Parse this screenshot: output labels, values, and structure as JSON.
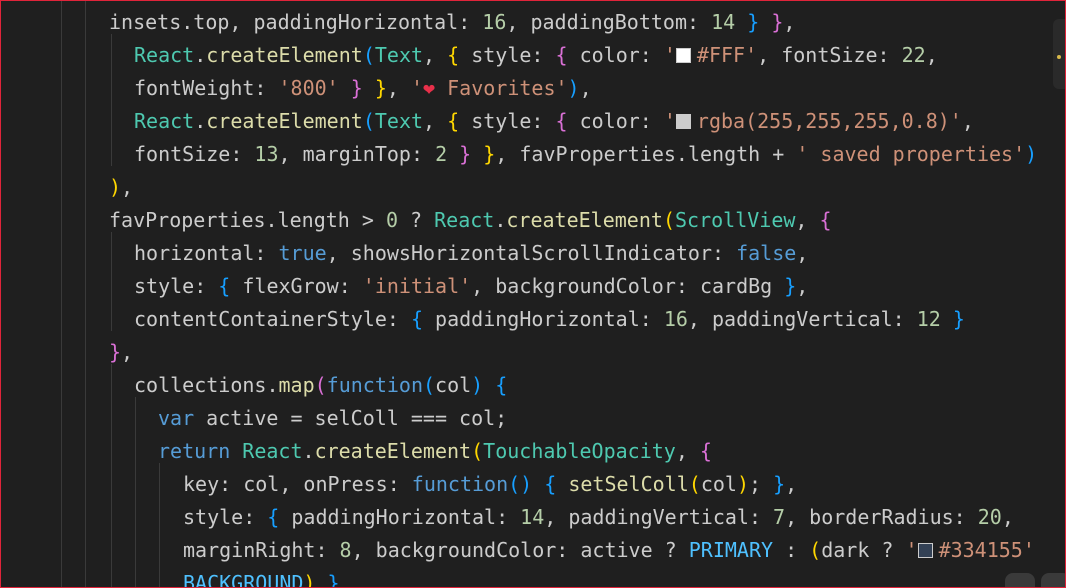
{
  "colors": {
    "background": "#1f1f1f",
    "frame_border": "#e0243a",
    "plain": "#cccccc",
    "variable": "#9cdcfe",
    "number": "#b5cea8",
    "string": "#ce9178",
    "component": "#4ec9b0",
    "keyword": "#569cd6",
    "function": "#dcdcaa",
    "constant": "#4fc1ff",
    "bracket_level_1": "#ffd700",
    "bracket_level_2": "#da70d6",
    "bracket_level_3": "#179fff"
  },
  "icons": {
    "heart": "heart-icon",
    "color_swatch": "color-swatch-icon"
  },
  "code_lines": [
    [
      {
        "t": "insets.top, paddingHorizontal: ",
        "c": "c-text"
      },
      {
        "t": "16",
        "c": "c-num"
      },
      {
        "t": ", paddingBottom: ",
        "c": "c-text"
      },
      {
        "t": "14",
        "c": "c-num"
      },
      {
        "t": " ",
        "c": "c-text"
      },
      {
        "t": "}",
        "c": "b3"
      },
      {
        "t": " ",
        "c": "c-text"
      },
      {
        "t": "}",
        "c": "b2"
      },
      {
        "t": ",",
        "c": "c-text"
      }
    ],
    [
      {
        "t": "React",
        "c": "c-cls"
      },
      {
        "t": ".",
        "c": "c-text"
      },
      {
        "t": "createElement",
        "c": "c-fn"
      },
      {
        "t": "(",
        "c": "b3"
      },
      {
        "t": "Text",
        "c": "c-cls"
      },
      {
        "t": ", ",
        "c": "c-text"
      },
      {
        "t": "{",
        "c": "b1"
      },
      {
        "t": " style: ",
        "c": "c-text"
      },
      {
        "t": "{",
        "c": "b2"
      },
      {
        "t": " color: ",
        "c": "c-text"
      },
      {
        "t": "'",
        "c": "c-str"
      },
      {
        "sw": "#ffffff"
      },
      {
        "t": "#FFF'",
        "c": "c-str"
      },
      {
        "t": ", fontSize: ",
        "c": "c-text"
      },
      {
        "t": "22",
        "c": "c-num"
      },
      {
        "t": ",",
        "c": "c-text"
      }
    ],
    [
      {
        "t": "fontWeight: ",
        "c": "c-text"
      },
      {
        "t": "'800'",
        "c": "c-str"
      },
      {
        "t": " ",
        "c": "c-text"
      },
      {
        "t": "}",
        "c": "b2"
      },
      {
        "t": " ",
        "c": "c-text"
      },
      {
        "t": "}",
        "c": "b1"
      },
      {
        "t": ", ",
        "c": "c-text"
      },
      {
        "t": "'",
        "c": "c-str"
      },
      {
        "t": "❤",
        "c": "heart",
        "n": "heart-icon"
      },
      {
        "t": " Favorites'",
        "c": "c-str"
      },
      {
        "t": ")",
        "c": "b3"
      },
      {
        "t": ",",
        "c": "c-text"
      }
    ],
    [
      {
        "t": "React",
        "c": "c-cls"
      },
      {
        "t": ".",
        "c": "c-text"
      },
      {
        "t": "createElement",
        "c": "c-fn"
      },
      {
        "t": "(",
        "c": "b3"
      },
      {
        "t": "Text",
        "c": "c-cls"
      },
      {
        "t": ", ",
        "c": "c-text"
      },
      {
        "t": "{",
        "c": "b1"
      },
      {
        "t": " style: ",
        "c": "c-text"
      },
      {
        "t": "{",
        "c": "b2"
      },
      {
        "t": " color: ",
        "c": "c-text"
      },
      {
        "t": "'",
        "c": "c-str"
      },
      {
        "sw": "#cccccc"
      },
      {
        "t": "rgba(255,255,255,0.8)'",
        "c": "c-str"
      },
      {
        "t": ",",
        "c": "c-text"
      }
    ],
    [
      {
        "t": "fontSize: ",
        "c": "c-text"
      },
      {
        "t": "13",
        "c": "c-num"
      },
      {
        "t": ", marginTop: ",
        "c": "c-text"
      },
      {
        "t": "2",
        "c": "c-num"
      },
      {
        "t": " ",
        "c": "c-text"
      },
      {
        "t": "}",
        "c": "b2"
      },
      {
        "t": " ",
        "c": "c-text"
      },
      {
        "t": "}",
        "c": "b1"
      },
      {
        "t": ", favProperties.length + ",
        "c": "c-text"
      },
      {
        "t": "' saved properties'",
        "c": "c-str"
      },
      {
        "t": ")",
        "c": "b3"
      }
    ],
    [
      {
        "t": ")",
        "c": "b1"
      },
      {
        "t": ",",
        "c": "c-text"
      }
    ],
    [
      {
        "t": "favProperties.length > ",
        "c": "c-text"
      },
      {
        "t": "0",
        "c": "c-num"
      },
      {
        "t": " ? ",
        "c": "c-text"
      },
      {
        "t": "React",
        "c": "c-cls"
      },
      {
        "t": ".",
        "c": "c-text"
      },
      {
        "t": "createElement",
        "c": "c-fn"
      },
      {
        "t": "(",
        "c": "b1"
      },
      {
        "t": "ScrollView",
        "c": "c-cls"
      },
      {
        "t": ", ",
        "c": "c-text"
      },
      {
        "t": "{",
        "c": "b2"
      }
    ],
    [
      {
        "t": "horizontal: ",
        "c": "c-text"
      },
      {
        "t": "true",
        "c": "c-key"
      },
      {
        "t": ", showsHorizontalScrollIndicator: ",
        "c": "c-text"
      },
      {
        "t": "false",
        "c": "c-key"
      },
      {
        "t": ",",
        "c": "c-text"
      }
    ],
    [
      {
        "t": "style: ",
        "c": "c-text"
      },
      {
        "t": "{",
        "c": "b3"
      },
      {
        "t": " flexGrow: ",
        "c": "c-text"
      },
      {
        "t": "'initial'",
        "c": "c-str"
      },
      {
        "t": ", backgroundColor: cardBg ",
        "c": "c-text"
      },
      {
        "t": "}",
        "c": "b3"
      },
      {
        "t": ",",
        "c": "c-text"
      }
    ],
    [
      {
        "t": "contentContainerStyle: ",
        "c": "c-text"
      },
      {
        "t": "{",
        "c": "b3"
      },
      {
        "t": " paddingHorizontal: ",
        "c": "c-text"
      },
      {
        "t": "16",
        "c": "c-num"
      },
      {
        "t": ", paddingVertical: ",
        "c": "c-text"
      },
      {
        "t": "12",
        "c": "c-num"
      },
      {
        "t": " ",
        "c": "c-text"
      },
      {
        "t": "}",
        "c": "b3"
      }
    ],
    [
      {
        "t": "}",
        "c": "b2"
      },
      {
        "t": ",",
        "c": "c-text"
      }
    ],
    [
      {
        "t": "collections.",
        "c": "c-text"
      },
      {
        "t": "map",
        "c": "c-fn"
      },
      {
        "t": "(",
        "c": "b2"
      },
      {
        "t": "function",
        "c": "c-key"
      },
      {
        "t": "(",
        "c": "b3"
      },
      {
        "t": "col",
        "c": "c-text"
      },
      {
        "t": ")",
        "c": "b3"
      },
      {
        "t": " ",
        "c": "c-text"
      },
      {
        "t": "{",
        "c": "b3"
      }
    ],
    [
      {
        "t": "var",
        "c": "c-key"
      },
      {
        "t": " active = selColl === col;",
        "c": "c-text"
      }
    ],
    [
      {
        "t": "return",
        "c": "c-key"
      },
      {
        "t": " ",
        "c": "c-text"
      },
      {
        "t": "React",
        "c": "c-cls"
      },
      {
        "t": ".",
        "c": "c-text"
      },
      {
        "t": "createElement",
        "c": "c-fn"
      },
      {
        "t": "(",
        "c": "b1"
      },
      {
        "t": "TouchableOpacity",
        "c": "c-cls"
      },
      {
        "t": ", ",
        "c": "c-text"
      },
      {
        "t": "{",
        "c": "b2"
      }
    ],
    [
      {
        "t": "key: col, onPress: ",
        "c": "c-text"
      },
      {
        "t": "function",
        "c": "c-key"
      },
      {
        "t": "()",
        "c": "b3"
      },
      {
        "t": " ",
        "c": "c-text"
      },
      {
        "t": "{",
        "c": "b3"
      },
      {
        "t": " ",
        "c": "c-text"
      },
      {
        "t": "setSelColl",
        "c": "c-fn"
      },
      {
        "t": "(",
        "c": "b1"
      },
      {
        "t": "col",
        "c": "c-text"
      },
      {
        "t": ")",
        "c": "b1"
      },
      {
        "t": "; ",
        "c": "c-text"
      },
      {
        "t": "}",
        "c": "b3"
      },
      {
        "t": ",",
        "c": "c-text"
      }
    ],
    [
      {
        "t": "style: ",
        "c": "c-text"
      },
      {
        "t": "{",
        "c": "b3"
      },
      {
        "t": " paddingHorizontal: ",
        "c": "c-text"
      },
      {
        "t": "14",
        "c": "c-num"
      },
      {
        "t": ", paddingVertical: ",
        "c": "c-text"
      },
      {
        "t": "7",
        "c": "c-num"
      },
      {
        "t": ", borderRadius: ",
        "c": "c-text"
      },
      {
        "t": "20",
        "c": "c-num"
      },
      {
        "t": ",",
        "c": "c-text"
      }
    ],
    [
      {
        "t": "marginRight: ",
        "c": "c-text"
      },
      {
        "t": "8",
        "c": "c-num"
      },
      {
        "t": ", backgroundColor: active ? ",
        "c": "c-text"
      },
      {
        "t": "PRIMARY",
        "c": "c-const"
      },
      {
        "t": " : ",
        "c": "c-text"
      },
      {
        "t": "(",
        "c": "b1"
      },
      {
        "t": "dark ? ",
        "c": "c-text"
      },
      {
        "t": "'",
        "c": "c-str"
      },
      {
        "sw": "#334155"
      },
      {
        "t": "#334155'",
        "c": "c-str"
      }
    ],
    [
      {
        "t": "BACKGROUND",
        "c": "c-const"
      },
      {
        "t": ")",
        "c": "b1"
      },
      {
        "t": " ",
        "c": "c-text"
      },
      {
        "t": "}",
        "c": "b3"
      },
      {
        "t": ",",
        "c": "c-text"
      }
    ]
  ]
}
